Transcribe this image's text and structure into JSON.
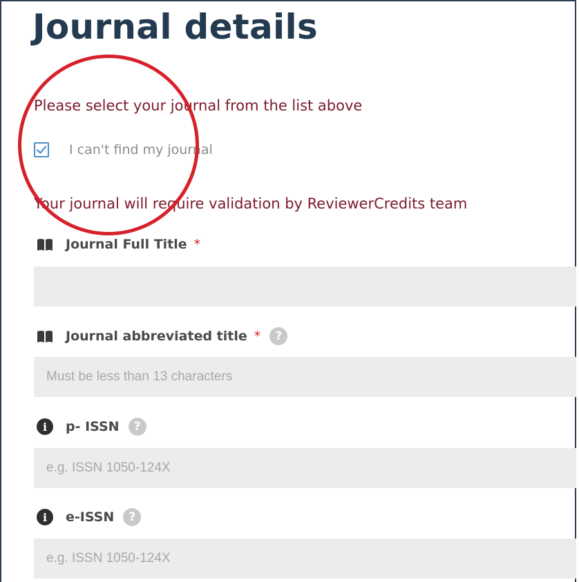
{
  "page_title": "Journal details",
  "messages": {
    "select_prompt": "Please select your journal from the list above",
    "validation_note": "Your journal will require validation by ReviewerCredits team"
  },
  "checkbox": {
    "label": "I can't find my journal",
    "checked": true
  },
  "fields": {
    "full_title": {
      "label": "Journal Full Title",
      "required_mark": "*",
      "value": "",
      "placeholder": ""
    },
    "abbrev_title": {
      "label": "Journal abbreviated title",
      "required_mark": "*",
      "help": "?",
      "placeholder": "Must be less than 13 characters"
    },
    "p_issn": {
      "label": "p- ISSN",
      "help": "?",
      "placeholder": "e.g. ISSN 1050-124X"
    },
    "e_issn": {
      "label": "e-ISSN",
      "help": "?",
      "placeholder": "e.g. ISSN 1050-124X"
    }
  },
  "icons": {
    "book": "book-icon",
    "info": "info-icon",
    "info_glyph": "i",
    "help": "help-icon",
    "check": "checkmark-icon"
  },
  "colors": {
    "title": "#233a50",
    "message": "#7a1a2b",
    "checkbox": "#4a90c8",
    "required": "#d7212a",
    "annotation": "#d7212a",
    "input_bg": "#ececec"
  }
}
